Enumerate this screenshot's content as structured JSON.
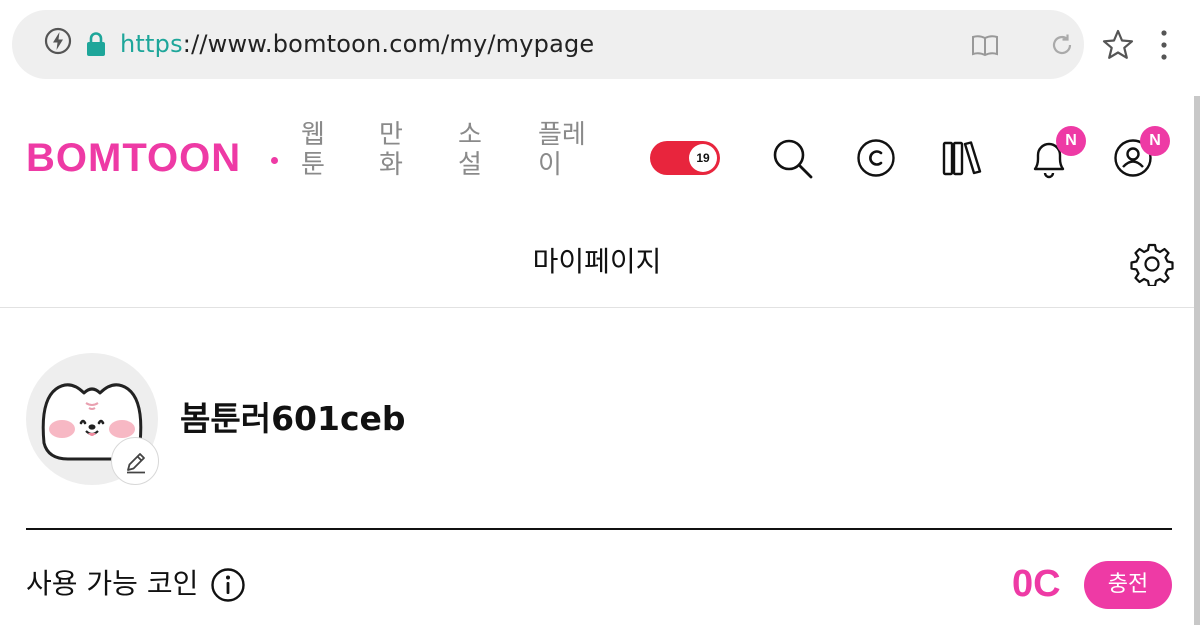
{
  "browser": {
    "url_scheme": "https",
    "url_rest": "://www.bomtoon.com/my/mypage",
    "icons": [
      "bolt-icon",
      "lock-icon",
      "reader-mode-icon",
      "reload-icon",
      "star-icon",
      "kebab-menu-icon"
    ]
  },
  "header": {
    "logo": "BOMTOON",
    "categories": [
      {
        "line1": "웹",
        "line2": "툰"
      },
      {
        "line1": "만",
        "line2": "화"
      },
      {
        "line1": "소",
        "line2": "설"
      },
      {
        "line1": "플레",
        "line2": "이"
      }
    ],
    "adult_toggle_label": "19",
    "bell_badge": "N",
    "profile_badge": "N",
    "colors": {
      "brand": "#ee3aa5",
      "toggle_on": "#e8253d"
    }
  },
  "page": {
    "title": "마이페이지"
  },
  "profile": {
    "username": "봄툰러601ceb"
  },
  "coins": {
    "label": "사용 가능 코인",
    "amount": "0C",
    "charge_label": "충전"
  }
}
